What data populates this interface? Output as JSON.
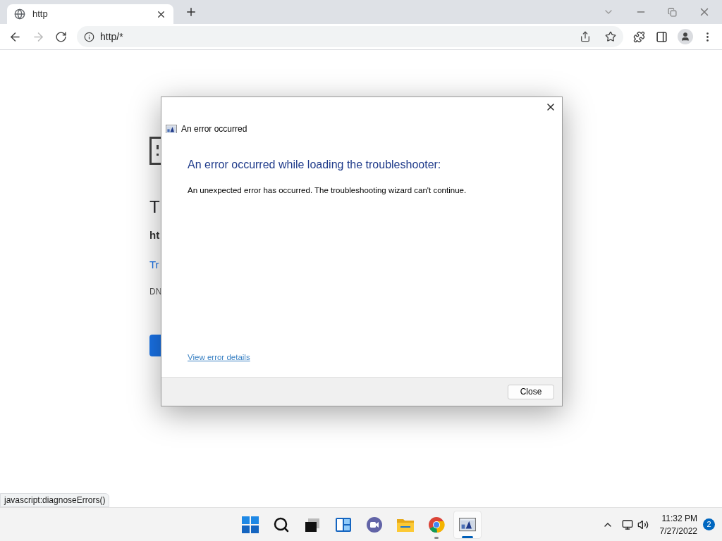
{
  "browser": {
    "tab": {
      "title": "http"
    },
    "address": "http/*"
  },
  "page": {
    "heading": "T",
    "url": "ht",
    "link": "Tr",
    "detail": "DN"
  },
  "dialog": {
    "caption": "An error occurred",
    "heading": "An error occurred while loading the troubleshooter:",
    "message": "An unexpected error has occurred. The troubleshooting wizard can't continue.",
    "link": "View error details",
    "buttons": [
      "Close"
    ]
  },
  "status_bubble": "javascript:diagnoseErrors()",
  "taskbar": {
    "apps": [
      {
        "kind": "start",
        "running": false,
        "selected": false
      },
      {
        "kind": "search",
        "running": false,
        "selected": false
      },
      {
        "kind": "taskview",
        "running": false,
        "selected": false
      },
      {
        "kind": "widgets",
        "running": false,
        "selected": false
      },
      {
        "kind": "chat",
        "running": false,
        "selected": false
      },
      {
        "kind": "explorer",
        "running": false,
        "selected": false
      },
      {
        "kind": "chrome",
        "running": true,
        "selected": false
      },
      {
        "kind": "troubleshooter",
        "running": true,
        "selected": true
      }
    ],
    "time": "11:32 PM",
    "date": "7/27/2022",
    "badge": "2"
  }
}
